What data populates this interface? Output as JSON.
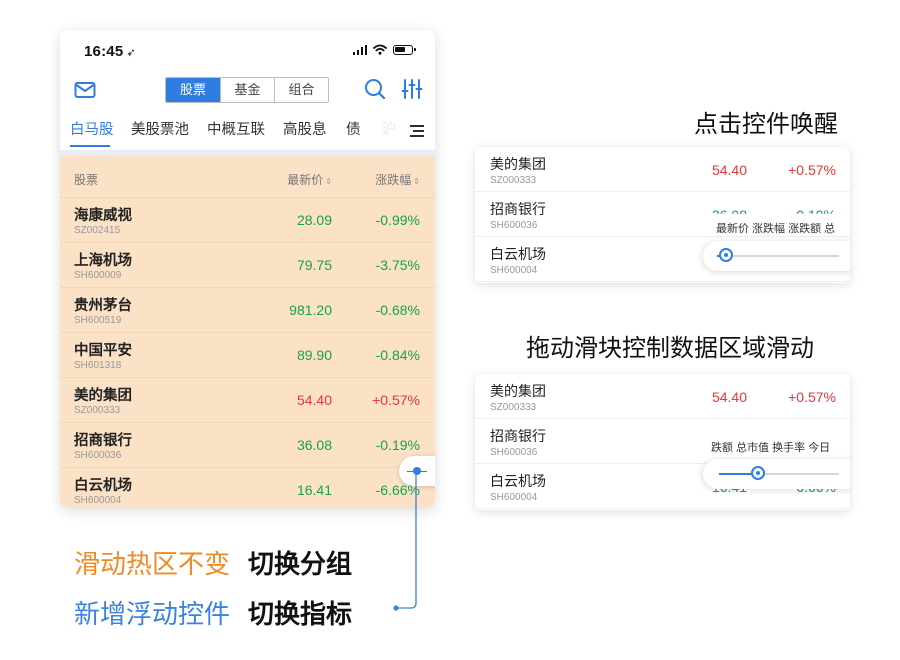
{
  "status_bar": {
    "time": "16:45",
    "location_glyph": "➶"
  },
  "toolbar": {
    "segments": [
      "股票",
      "基金",
      "组合"
    ],
    "active_segment": "股票",
    "icons": [
      "mail-icon",
      "search-icon",
      "filter-icon"
    ]
  },
  "tabs": {
    "items": [
      "白马股",
      "美股票池",
      "中概互联",
      "高股息",
      "债",
      "沪"
    ],
    "active": "白马股",
    "menu_icon": "menu-icon"
  },
  "list": {
    "headers": {
      "name": "股票",
      "price": "最新价",
      "change": "涨跌幅"
    },
    "rows": [
      {
        "name": "海康威视",
        "code": "SZ002415",
        "price": "28.09",
        "change": "-0.99%",
        "dir": "down"
      },
      {
        "name": "上海机场",
        "code": "SH600009",
        "price": "79.75",
        "change": "-3.75%",
        "dir": "down"
      },
      {
        "name": "贵州茅台",
        "code": "SH600519",
        "price": "981.20",
        "change": "-0.68%",
        "dir": "down"
      },
      {
        "name": "中国平安",
        "code": "SH601318",
        "price": "89.90",
        "change": "-0.84%",
        "dir": "down"
      },
      {
        "name": "美的集团",
        "code": "SZ000333",
        "price": "54.40",
        "change": "+0.57%",
        "dir": "up"
      },
      {
        "name": "招商银行",
        "code": "SH600036",
        "price": "36.08",
        "change": "-0.19%",
        "dir": "down"
      },
      {
        "name": "白云机场",
        "code": "SH600004",
        "price": "16.41",
        "change": "-6.66%",
        "dir": "down"
      }
    ]
  },
  "legend": {
    "line1": {
      "colored": "滑动热区不变",
      "bold": "切换分组"
    },
    "line2": {
      "colored": "新增浮动控件",
      "bold": "切换指标"
    }
  },
  "panel1": {
    "caption": "点击控件唤醒",
    "rows": [
      {
        "name": "美的集团",
        "code": "SZ000333",
        "price": "54.40",
        "change": "+0.57%"
      },
      {
        "name": "招商银行",
        "code": "SH600036",
        "price": "36.08",
        "change": "-0.19%"
      },
      {
        "name": "白云机场",
        "code": "SH600004"
      }
    ],
    "popup_labels": "最新价 涨跌幅 涨跌额 总",
    "slider_position": 0.05
  },
  "panel2": {
    "caption": "拖动滑块控制数据区域滑动",
    "rows": [
      {
        "name": "美的集团",
        "code": "SZ000333",
        "price": "54.40",
        "change": "+0.57%"
      },
      {
        "name": "招商银行",
        "code": "SH600036"
      },
      {
        "name": "白云机场",
        "code": "SH600004",
        "price": "16.41",
        "change": "-6.66%"
      }
    ],
    "popup_labels": "跌额 总市值 换手率 今日",
    "slider_position": 0.3
  },
  "colors": {
    "accent": "#2f7de1",
    "up": "#e5363a",
    "down": "#16a34a",
    "highlight": "#fbe1c6",
    "orange": "#f08a24"
  }
}
